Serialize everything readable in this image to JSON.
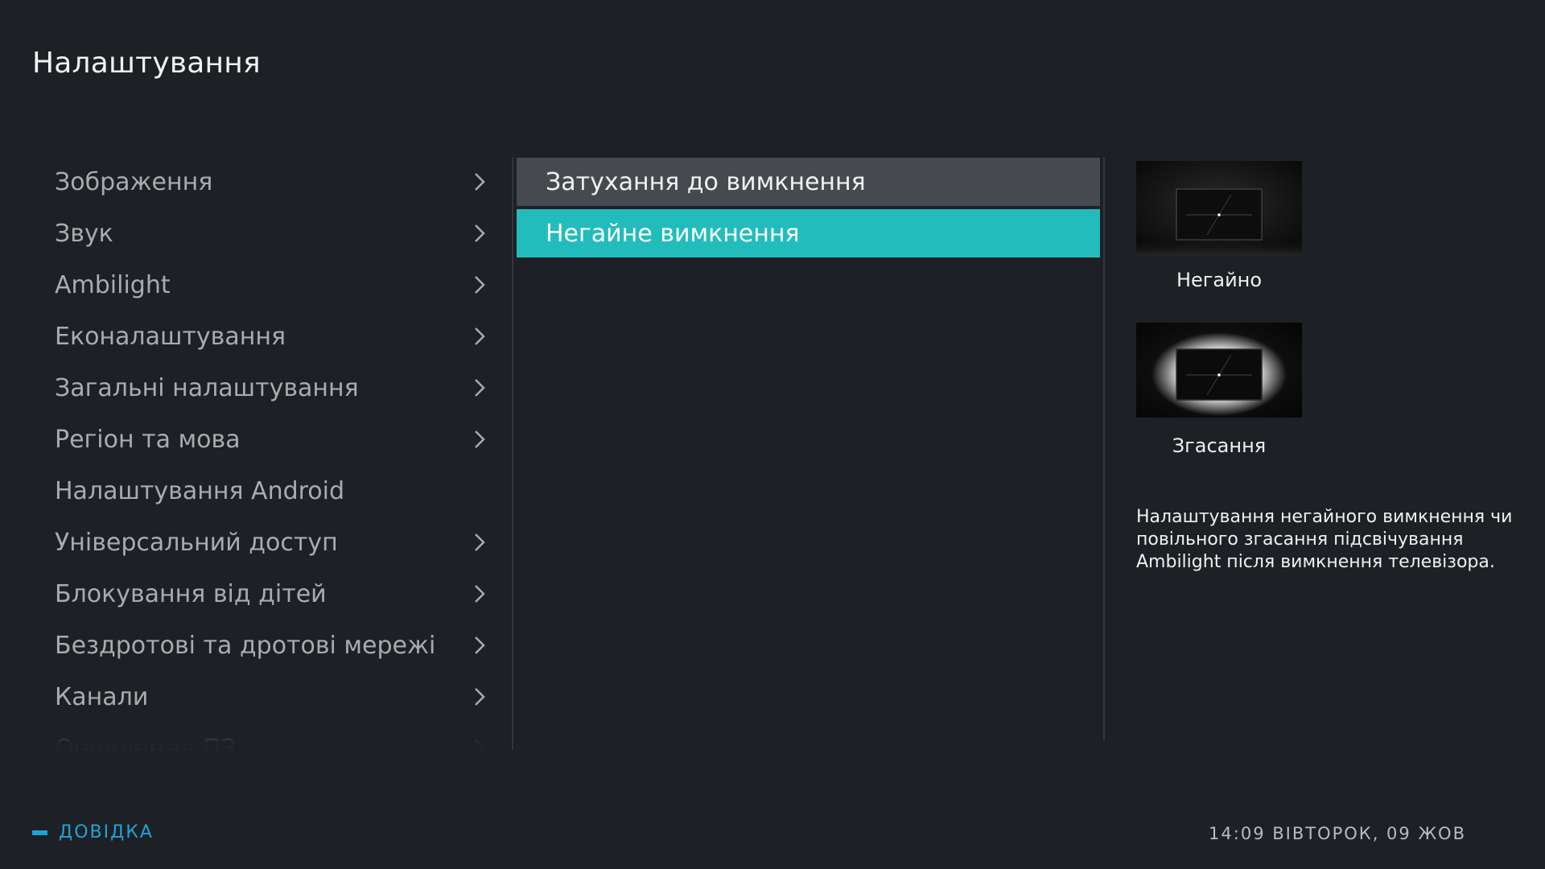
{
  "header": {
    "title": "Налаштування"
  },
  "menu": {
    "items": [
      {
        "label": "Зображення",
        "has_submenu": true
      },
      {
        "label": "Звук",
        "has_submenu": true
      },
      {
        "label": "Ambilight",
        "has_submenu": true
      },
      {
        "label": "Еконалаштування",
        "has_submenu": true
      },
      {
        "label": "Загальні налаштування",
        "has_submenu": true
      },
      {
        "label": "Регіон та мова",
        "has_submenu": true
      },
      {
        "label": "Налаштування Android",
        "has_submenu": false
      },
      {
        "label": "Універсальний доступ",
        "has_submenu": true
      },
      {
        "label": "Блокування від дітей",
        "has_submenu": true
      },
      {
        "label": "Бездротові та дротові мережі",
        "has_submenu": true
      },
      {
        "label": "Канали",
        "has_submenu": true
      },
      {
        "label": "Оновлення ПЗ",
        "has_submenu": true
      }
    ]
  },
  "options": [
    {
      "label": "Затухання до вимкнення",
      "state": "highlighted"
    },
    {
      "label": "Негайне вимкнення",
      "state": "selected"
    }
  ],
  "previews": [
    {
      "caption": "Негайно"
    },
    {
      "caption": "Згасання"
    }
  ],
  "description": "Налаштування негайного вимкнення чи повільного згасання підсвічування Ambilight після вимкнення телевізора.",
  "footer": {
    "help_label": "ДОВІДКА",
    "clock": "14:09 ВІВТОРОК, 09 ЖОВ"
  },
  "colors": {
    "background": "#1d2024",
    "selected": "#23bcbc",
    "highlighted": "#464a4f",
    "help_accent": "#1ea3d8"
  }
}
